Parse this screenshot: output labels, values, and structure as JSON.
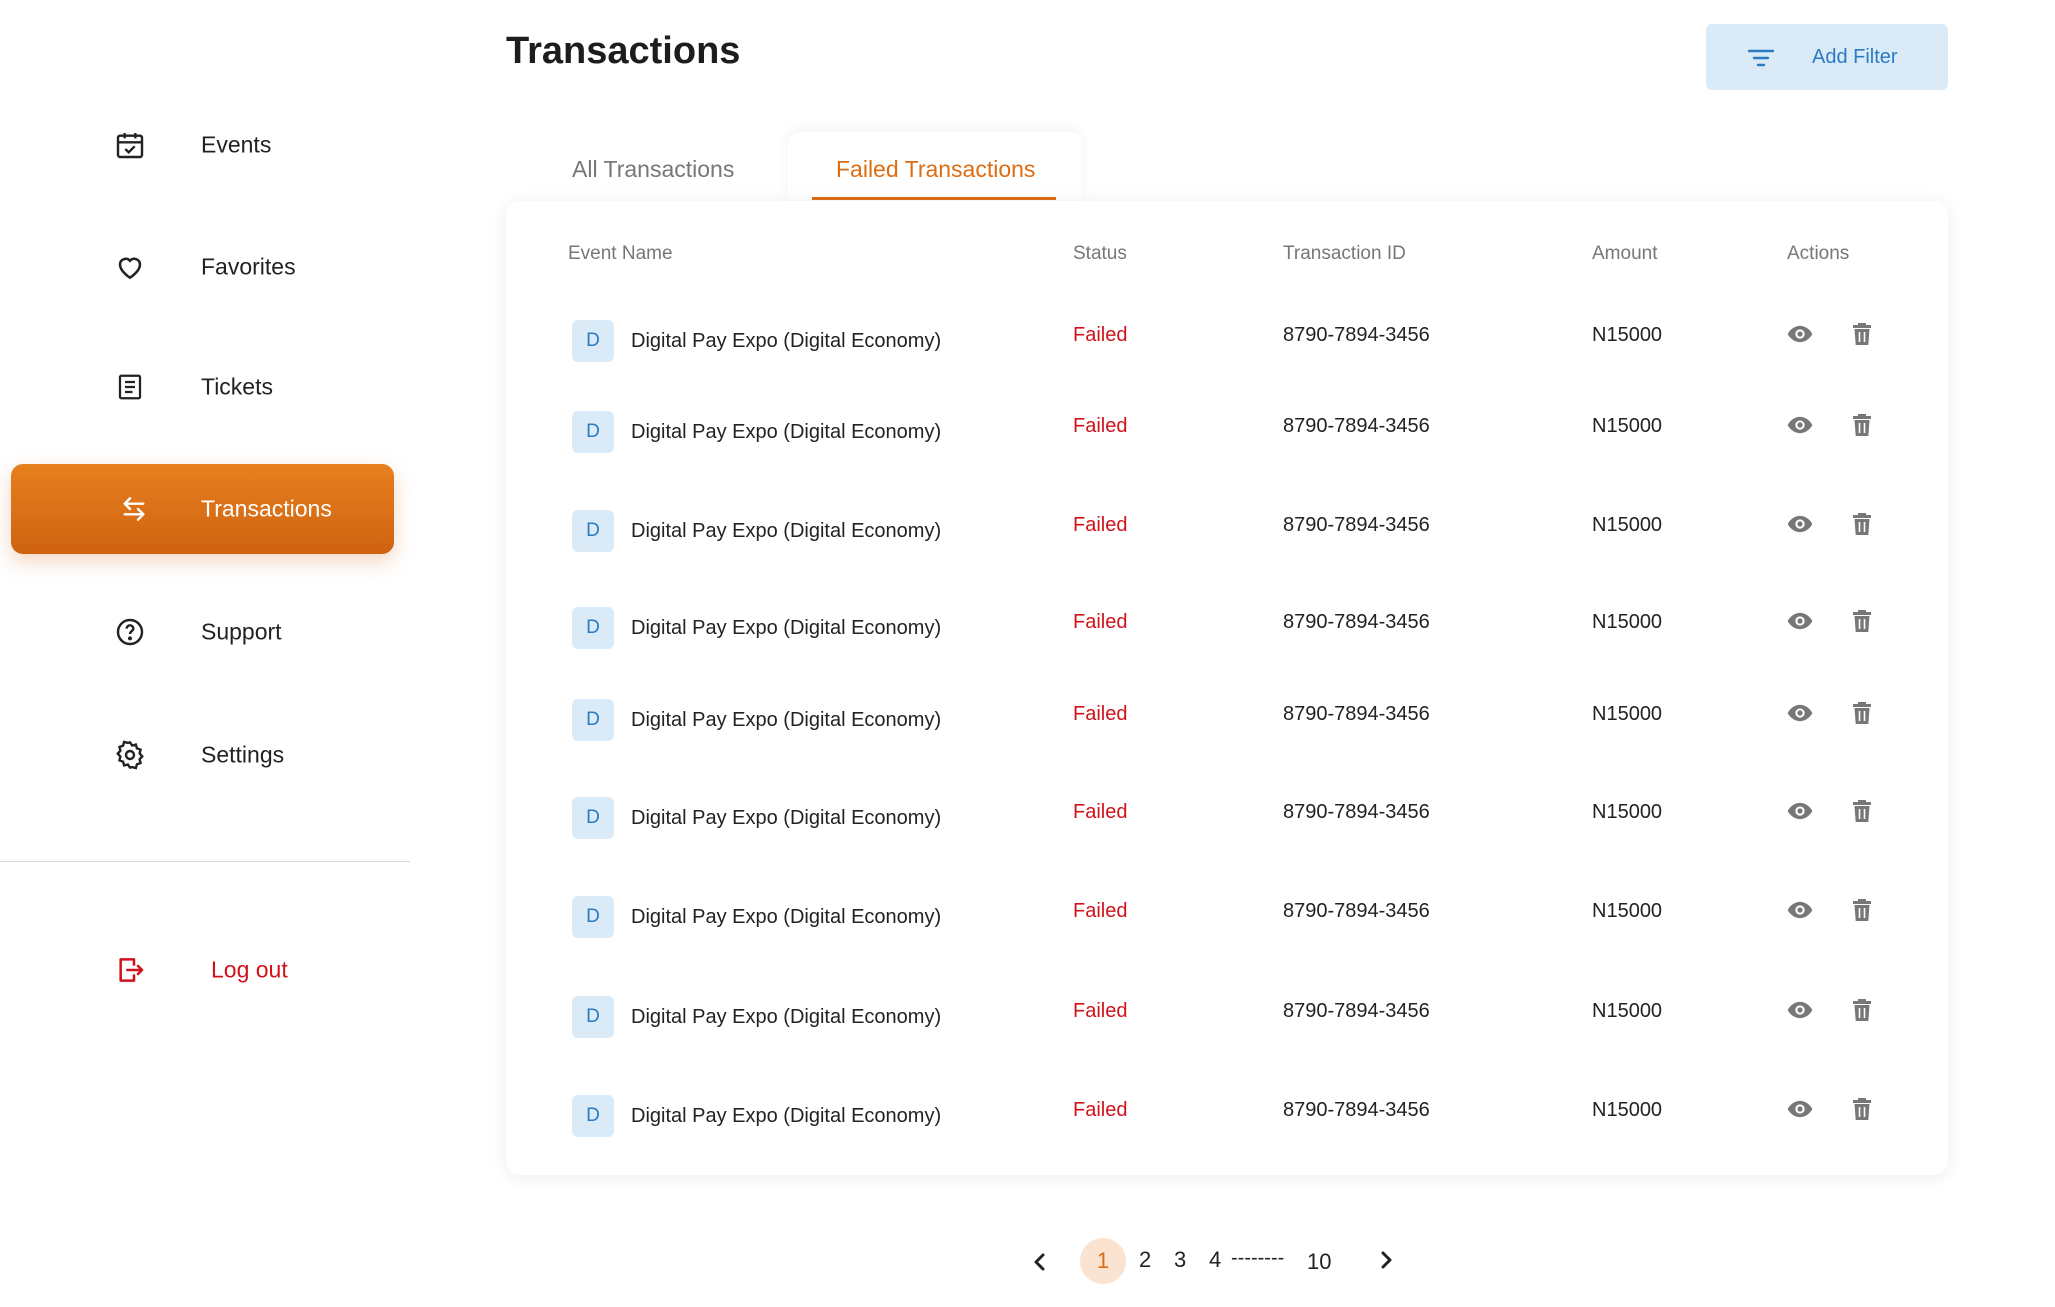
{
  "sidebar": {
    "items": [
      {
        "label": "Events",
        "icon": "calendar-check-icon"
      },
      {
        "label": "Favorites",
        "icon": "heart-icon"
      },
      {
        "label": "Tickets",
        "icon": "ticket-list-icon"
      },
      {
        "label": "Transactions",
        "icon": "transfer-arrows-icon"
      },
      {
        "label": "Support",
        "icon": "help-circle-icon"
      },
      {
        "label": "Settings",
        "icon": "gear-icon"
      }
    ],
    "logout": {
      "label": "Log out",
      "icon": "logout-icon"
    },
    "active_index": 3
  },
  "header": {
    "title": "Transactions",
    "filter_label": "Add Filter"
  },
  "tabs": {
    "all": "All Transactions",
    "failed": "Failed Transactions",
    "active": "failed"
  },
  "table": {
    "headers": {
      "event_name": "Event Name",
      "status": "Status",
      "transaction_id": "Transaction ID",
      "amount": "Amount",
      "actions": "Actions"
    },
    "rows": [
      {
        "initial": "D",
        "event": "Digital Pay Expo (Digital Economy)",
        "status": "Failed",
        "id": "8790-7894-3456",
        "amount": "N15000"
      },
      {
        "initial": "D",
        "event": "Digital Pay Expo (Digital Economy)",
        "status": "Failed",
        "id": "8790-7894-3456",
        "amount": "N15000"
      },
      {
        "initial": "D",
        "event": "Digital Pay Expo (Digital Economy)",
        "status": "Failed",
        "id": "8790-7894-3456",
        "amount": "N15000"
      },
      {
        "initial": "D",
        "event": "Digital Pay Expo (Digital Economy)",
        "status": "Failed",
        "id": "8790-7894-3456",
        "amount": "N15000"
      },
      {
        "initial": "D",
        "event": "Digital Pay Expo (Digital Economy)",
        "status": "Failed",
        "id": "8790-7894-3456",
        "amount": "N15000"
      },
      {
        "initial": "D",
        "event": "Digital Pay Expo (Digital Economy)",
        "status": "Failed",
        "id": "8790-7894-3456",
        "amount": "N15000"
      },
      {
        "initial": "D",
        "event": "Digital Pay Expo (Digital Economy)",
        "status": "Failed",
        "id": "8790-7894-3456",
        "amount": "N15000"
      },
      {
        "initial": "D",
        "event": "Digital Pay Expo (Digital Economy)",
        "status": "Failed",
        "id": "8790-7894-3456",
        "amount": "N15000"
      },
      {
        "initial": "D",
        "event": "Digital Pay Expo (Digital Economy)",
        "status": "Failed",
        "id": "8790-7894-3456",
        "amount": "N15000"
      }
    ]
  },
  "pagination": {
    "current": "1",
    "pages": [
      "2",
      "3",
      "4"
    ],
    "ellipsis": "--------",
    "last": "10"
  },
  "colors": {
    "accent": "#de6d12",
    "failed": "#d0121b",
    "avatar_bg": "#dbeaf7",
    "avatar_text": "#2a7bc4"
  }
}
